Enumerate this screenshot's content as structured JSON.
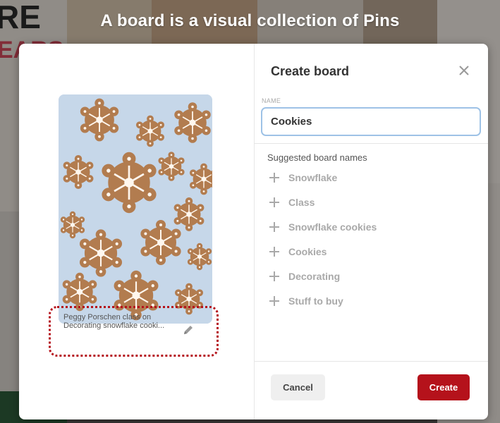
{
  "banner": {
    "text": "A board is a visual collection of Pins"
  },
  "background": {
    "fragments": [
      "RE",
      "EARS"
    ]
  },
  "pin": {
    "caption": "Peggy Porschen class on Decorating snowflake cooki...",
    "edit_icon": "pencil-icon"
  },
  "dialog": {
    "title": "Create board",
    "close_icon": "close-icon",
    "name_label": "NAME",
    "name_value": "Cookies",
    "suggested_title": "Suggested board names",
    "suggestions": [
      "Snowflake",
      "Class",
      "Snowflake cookies",
      "Cookies",
      "Decorating",
      "Stuff to buy"
    ],
    "cancel_label": "Cancel",
    "create_label": "Create"
  },
  "colors": {
    "accent": "#b5121b",
    "input_focus": "#9ec2e6",
    "annotation": "#b5121b"
  }
}
